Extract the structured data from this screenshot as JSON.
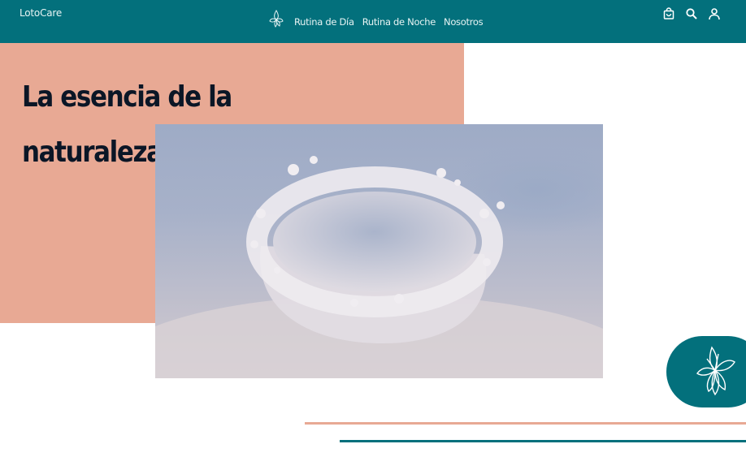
{
  "header": {
    "brand": "LotoCare",
    "nav": [
      "Rutina de Día",
      "Rutina de Noche",
      "Nosotros"
    ]
  },
  "hero": {
    "headline": "La esencia de la naturaleza en tu piel"
  },
  "icons": {
    "logo": "lotus-icon",
    "cart": "shopping-bag-icon",
    "search": "search-icon",
    "account": "user-icon",
    "badge": "lotus-icon"
  },
  "colors": {
    "header": "#03707c",
    "hero": "#e8a994",
    "text": "#0b1626",
    "accent_line_1": "#e8a994",
    "accent_line_2": "#03707c"
  }
}
